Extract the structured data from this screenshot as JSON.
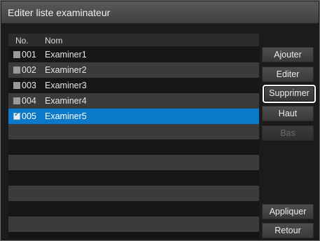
{
  "window": {
    "title": "Editer liste examinateur"
  },
  "list": {
    "columns": {
      "no": "No.",
      "nom": "Nom"
    },
    "rows": [
      {
        "no": "001",
        "name": "Examiner1",
        "checked": false
      },
      {
        "no": "002",
        "name": "Examiner2",
        "checked": false
      },
      {
        "no": "003",
        "name": "Examiner3",
        "checked": false
      },
      {
        "no": "004",
        "name": "Examiner4",
        "checked": false
      },
      {
        "no": "005",
        "name": "Examiner5",
        "checked": true
      }
    ],
    "empty_rows": 7,
    "selected_color": "#0a79c9"
  },
  "buttons": {
    "ajouter": "Ajouter",
    "editer": "Editer",
    "supprimer": "Supprimer",
    "haut": "Haut",
    "bas": "Bas",
    "appliquer": "Appliquer",
    "retour": "Retour"
  }
}
